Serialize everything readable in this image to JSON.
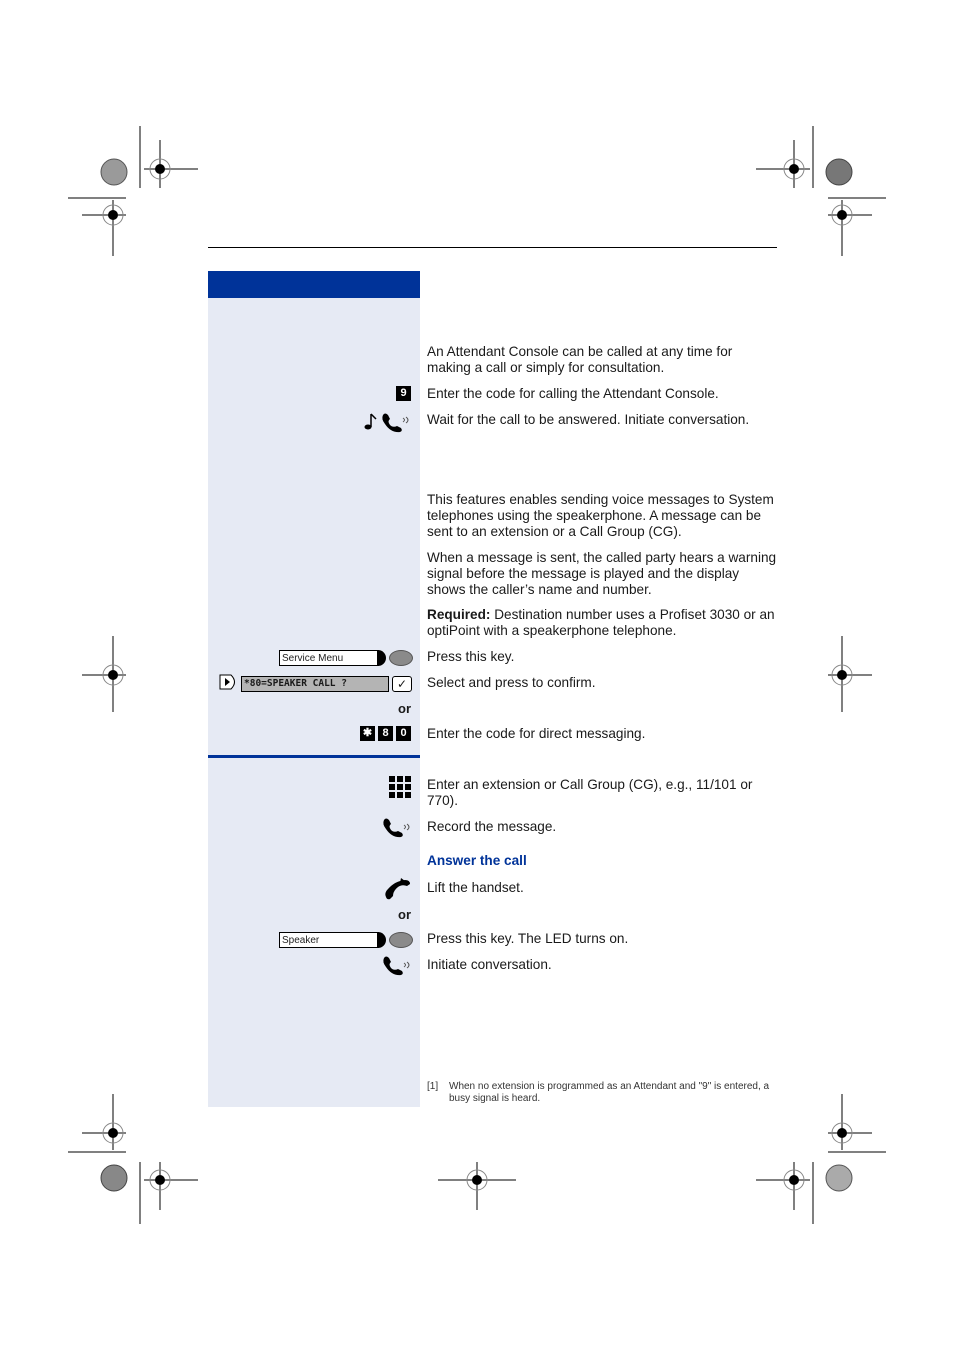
{
  "sidebar_steps": {
    "attendant_code_key": "9",
    "service_menu_key": "Service Menu",
    "display_text": "*80=SPEAKER CALL ?",
    "check_glyph": "✓",
    "or_label_1": "or",
    "code_keys": [
      "✱",
      "8",
      "0"
    ],
    "or_label_2": "or",
    "speaker_key": "Speaker"
  },
  "content": {
    "intro": "An Attendant Console can be called at any time for making a call or simply for consultation.",
    "enter_code": "Enter the code for calling the Attendant Console.",
    "wait_answer": "Wait for the call to be answered. Initiate conversation.",
    "speaker_para1": "This features enables sending voice messages to System telephones using the speakerphone. A message can be sent to an extension or a Call Group (CG).",
    "speaker_para2": "When a message is sent, the called party hears a warning signal before the message is played and the display shows the caller’s name and number.",
    "required_label": "Required:",
    "required_text": " Destination number uses a Profiset 3030 or an optiPoint with a speakerphone telephone.",
    "press_key": "Press this key.",
    "select_confirm": "Select and press to confirm.",
    "enter_direct": "Enter the code for direct messaging.",
    "enter_extension": "Enter an extension or Call Group (CG), e.g., 11/101 or 770).",
    "record": "Record the message.",
    "answer_heading": "Answer the call",
    "lift_handset": "Lift the handset.",
    "press_led": "Press this key. The LED turns on.",
    "initiate": "Initiate conversation."
  },
  "footnote": {
    "number": "[1]",
    "text": "When no extension is programmed as an Attendant and \"9\" is entered, a busy signal is heard."
  },
  "colors": {
    "accent_blue": "#003399",
    "sidebar_bg": "#e6eaf4"
  }
}
